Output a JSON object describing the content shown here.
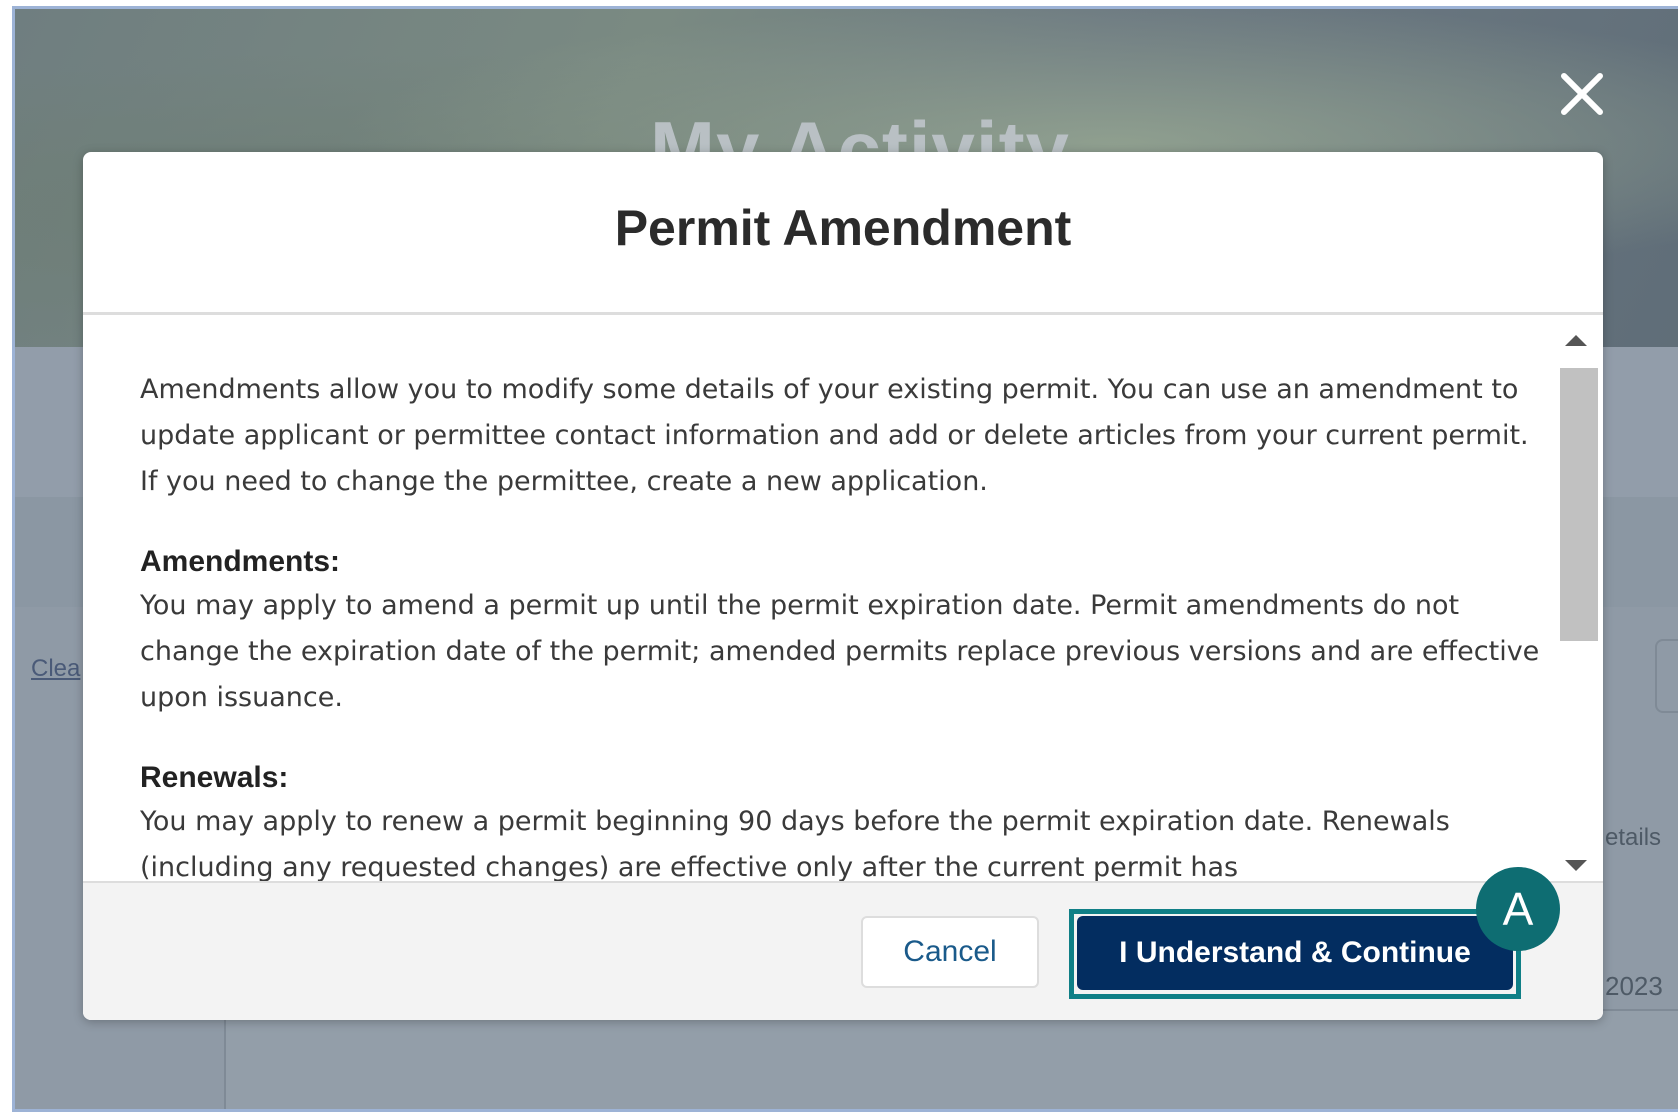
{
  "background": {
    "hero_title": "My Activity",
    "clear_link": "Clea",
    "details_text": "etails",
    "year_text": "2023"
  },
  "modal": {
    "title": "Permit Amendment",
    "intro": "Amendments allow you to modify some details of your existing permit. You can use an amendment to update applicant or permittee contact information and add or delete articles from your current permit. If you need to change the permittee, create a new application.",
    "sections": [
      {
        "heading": "Amendments:",
        "text": "You may apply to amend a permit up until the permit expiration date. Permit amendments do not change the expiration date of the permit; amended permits replace previous versions and are effective upon issuance."
      },
      {
        "heading": "Renewals:",
        "text": "You may apply to renew a permit beginning 90 days before the permit expiration date. Renewals (including any requested changes) are effective only after the current permit has"
      }
    ],
    "cancel_label": "Cancel",
    "continue_label": "I Understand & Continue"
  },
  "annotation": {
    "badge_label": "A",
    "badge_color": "#0e6d72"
  },
  "colors": {
    "primary_button": "#032d60",
    "highlight_outline": "#0f7f86",
    "cancel_text": "#1a5a8a"
  },
  "icons": {
    "close": "close-icon",
    "scroll_up": "scroll-up-arrow-icon",
    "scroll_down": "scroll-down-arrow-icon"
  }
}
